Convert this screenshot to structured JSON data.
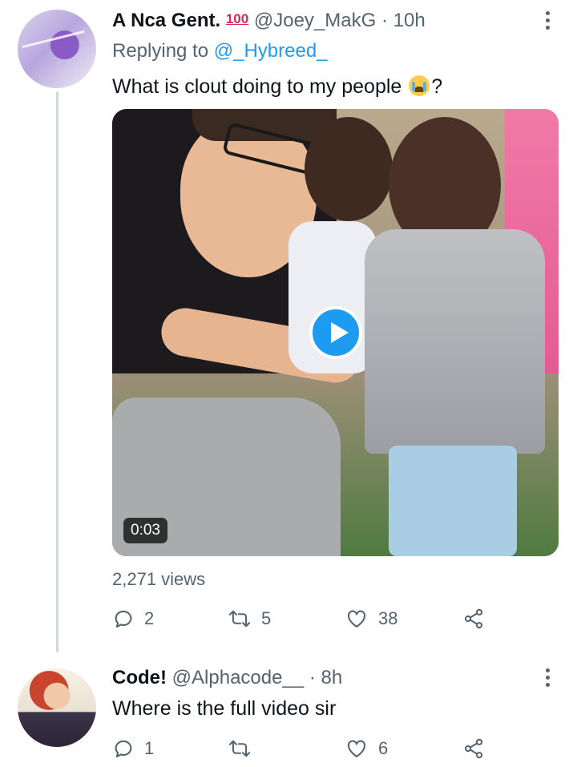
{
  "tweet1": {
    "name": "A Nca Gent.",
    "badge": "100",
    "handle": "@Joey_MakG",
    "dot": "·",
    "time": "10h",
    "replying_prefix": "Replying to",
    "replying_to": "@_Hybreed_",
    "text_before_emoji": "What is clout doing to my people",
    "text_after_emoji": "?",
    "emoji": "crying-face",
    "video": {
      "duration": "0:03"
    },
    "views": "2,271 views",
    "actions": {
      "replies": "2",
      "retweets": "5",
      "likes": "38"
    }
  },
  "tweet2": {
    "name": "Code!",
    "handle": "@Alphacode__",
    "dot": "·",
    "time": "8h",
    "text": "Where is the full video sir",
    "actions": {
      "replies": "1",
      "retweets": "",
      "likes": "6"
    }
  },
  "colors": {
    "accent": "#1d9bf0",
    "secondary_text": "#536471",
    "thread_line": "#cfd9de",
    "badge": "#e0245e"
  },
  "icons": [
    "more-icon",
    "reply-icon",
    "retweet-icon",
    "like-icon",
    "share-icon",
    "play-icon"
  ]
}
